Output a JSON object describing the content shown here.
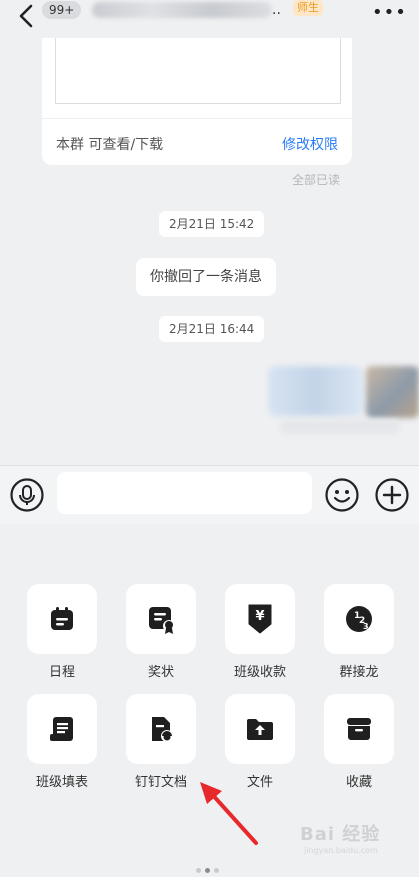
{
  "header": {
    "unread_count": "99+",
    "title_ellipsis": "..",
    "role_tag": "师生"
  },
  "file_card": {
    "permission_text": "本群 可查看/下载",
    "permission_button": "修改权限",
    "read_status": "全部已读"
  },
  "messages": {
    "time1": "2月21日 15:42",
    "recall_text": "你撤回了一条消息",
    "time2": "2月21日 16:44"
  },
  "input": {
    "placeholder": ""
  },
  "panel": {
    "items": [
      {
        "label": "日程",
        "icon": "calendar-icon"
      },
      {
        "label": "奖状",
        "icon": "certificate-icon"
      },
      {
        "label": "班级收款",
        "icon": "payment-icon"
      },
      {
        "label": "群接龙",
        "icon": "solitaire-icon"
      },
      {
        "label": "班级填表",
        "icon": "form-icon"
      },
      {
        "label": "钉钉文档",
        "icon": "document-icon"
      },
      {
        "label": "文件",
        "icon": "folder-upload-icon"
      },
      {
        "label": "收藏",
        "icon": "favorites-box-icon"
      }
    ]
  },
  "watermark": {
    "text": "Bai 经验",
    "sub": "jingyan.baidu.com"
  },
  "colors": {
    "accent": "#2b7cf6",
    "annotation_arrow": "#e8292c",
    "background": "#eff0f2"
  }
}
